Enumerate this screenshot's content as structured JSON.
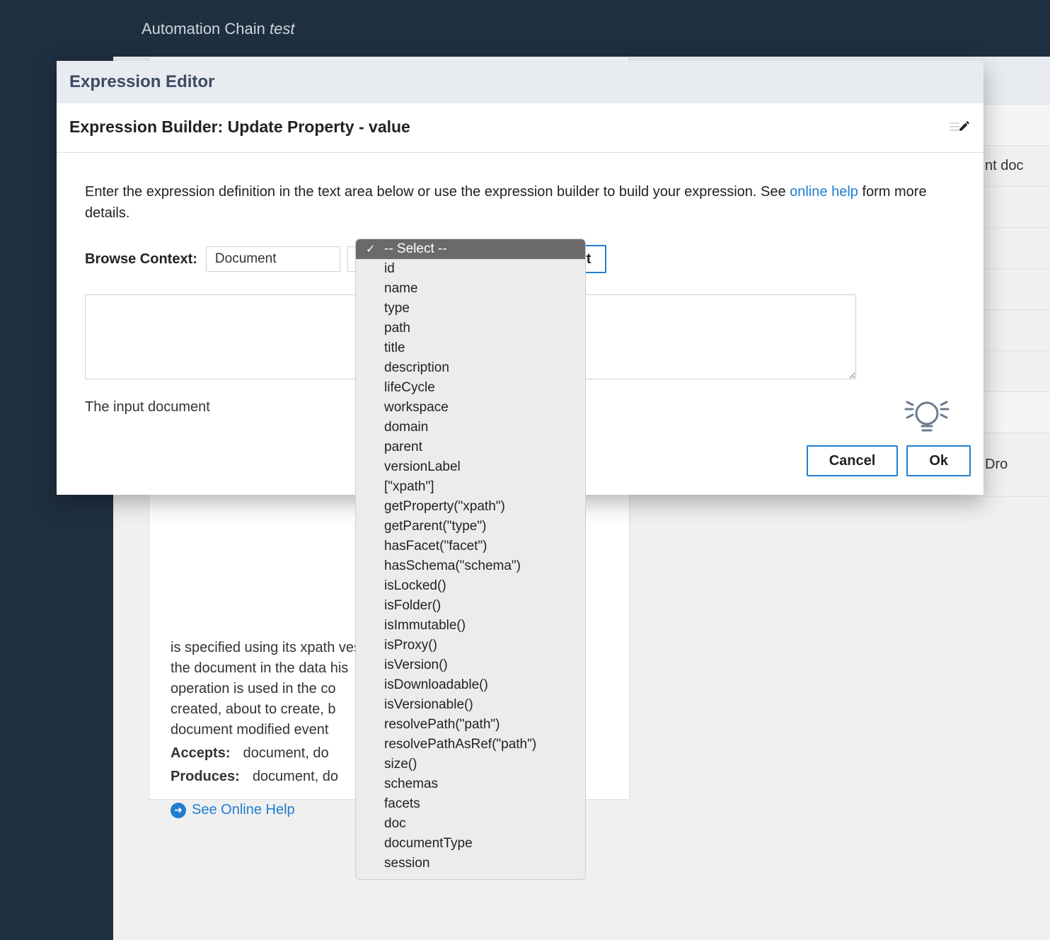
{
  "topbar": {
    "prefix": "Automation Chain ",
    "name": "test"
  },
  "modal": {
    "title": "Expression Editor",
    "subtitle": "Expression Builder: Update Property - value",
    "intro_before": "Enter the expression definition in the text area below or use the expression builder to build your expression. See ",
    "intro_link": "online help",
    "intro_after": " form more details.",
    "browse_label": "Browse Context:",
    "context_value": "Document",
    "insert_label": "Insert",
    "hint": "The input document",
    "cancel_label": "Cancel",
    "ok_label": "Ok"
  },
  "dropdown": {
    "selected": "-- Select --",
    "options": [
      "-- Select --",
      "id",
      "name",
      "type",
      "path",
      "title",
      "description",
      "lifeCycle",
      "workspace",
      "domain",
      "parent",
      "versionLabel",
      "[\"xpath\"]",
      "getProperty(\"xpath\")",
      "getParent(\"type\")",
      "hasFacet(\"facet\")",
      "hasSchema(\"schema\")",
      "isLocked()",
      "isFolder()",
      "isImmutable()",
      "isProxy()",
      "isVersion()",
      "isDownloadable()",
      "isVersionable()",
      "resolvePath(\"path\")",
      "resolvePathAsRef(\"path\")",
      "size()",
      "schemas",
      "facets",
      "doc",
      "documentType",
      "session"
    ]
  },
  "behind": {
    "line1": "is specified using its xpath                                            ves",
    "line2": "the document in the data                                                 his",
    "line3": "operation is used in the co",
    "line4": "created, about to create, b",
    "line5": "document modified event",
    "accepts_label": "Accepts:",
    "accepts_value": "document, do",
    "produces_label": "Produces:",
    "produces_value": "document, do",
    "help_link": "See Online Help"
  },
  "right_fragments": [
    "",
    "",
    "nt doc",
    "",
    "",
    "",
    "",
    "",
    "",
    "Dro"
  ]
}
